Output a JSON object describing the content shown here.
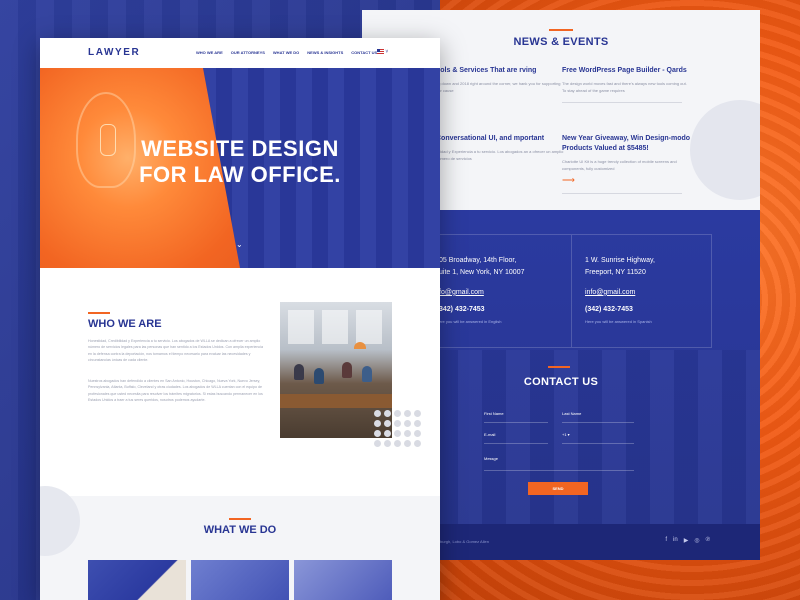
{
  "front": {
    "logo": "LAWYER",
    "nav": [
      "WHO WE ARE",
      "OUR ATTORNEYS",
      "WHAT WE DO",
      "NEWS & INSIGHTS",
      "CONTACT US"
    ],
    "language_flag": "us-flag-icon",
    "hero_title_line1": "WEBSITE DESIGN",
    "hero_title_line2": "FOR LAW OFFICE.",
    "who_title": "WHO WE ARE",
    "who_para1": "Honestidad, Credibilidad y Experiencia a tu servicio. Los abogados de WLLA se dedican a ofrecer un amplio número de servicios legales para las personas que han sentido a los Estados Unidos. Con amplia experiencia en la defensa contra la deportación, nos tomamos el tiempo necesario para evaluar las necesidades y circunstancias únicas de cada cliente.",
    "who_para2": "Nuestros abogados han defendido a clientes en San Antonio, Houston, Chicago, Nueva York, Nuevo Jersey, Pennsylvania, Atlanta, Buffalo, Cleveland y otras ciudades. Los abogados de WLLA cuentan con el equipo de profesionales que usted necesita para resolver los trámites migratorios. Si estas buscando permanecer en los Estados Unidos a traer a tus seres queridos, nosotros podemos ayudarte.",
    "whatwedo_title": "WHAT WE DO"
  },
  "back": {
    "news_title": "NEWS & EVENTS",
    "news": [
      {
        "title": "ools & Services That are rving",
        "text": "ng down and 2018 right around the corner, we hank you for supporting our cause"
      },
      {
        "title": "Free WordPress Page Builder - Qards",
        "text": "The design world moves fast and there's always new tools coming out. To stay ahead of the game requires"
      },
      {
        "title": "Conversational UI, and mportant",
        "text": "bilidad y Experiencia a tu servicio. Los abogados an a ofrecer un amplio número de servicios"
      },
      {
        "title": "New Year Giveaway, Win Design-modo Products Valued at $5485!",
        "text": "Charlotte UI Kit is a huge trendy collection of mobile screens and components, fully customized"
      }
    ],
    "offices": [
      {
        "addr1": "05 Broadway, 14th Floor,",
        "addr2": "uite 1, New York, NY 10007",
        "email": "fo@gmail.com",
        "phone": "342) 432-7453",
        "note": "ere you will be answered in English"
      },
      {
        "addr1": "1 W. Sunrise Highway,",
        "addr2": "Freeport, NY 11520",
        "email": "info@gmail.com",
        "phone": "(342) 432-7453",
        "note": "Here you will be answered in Spanish"
      }
    ],
    "contact_title": "CONTACT US",
    "form": {
      "first_name": "First Name",
      "last_name": "Last Name",
      "email": "E-mail",
      "phone_code": "+1 ▾",
      "message": "Messge",
      "send": "SEND"
    },
    "footer_copy": "burgh, Lobo & Gomez Allen",
    "socials": [
      "facebook-icon",
      "linkedin-icon",
      "youtube-icon",
      "instagram-icon",
      "pinterest-icon"
    ]
  },
  "colors": {
    "primary": "#283593",
    "accent": "#f26522",
    "blue_bg": "#2b3aa0"
  }
}
